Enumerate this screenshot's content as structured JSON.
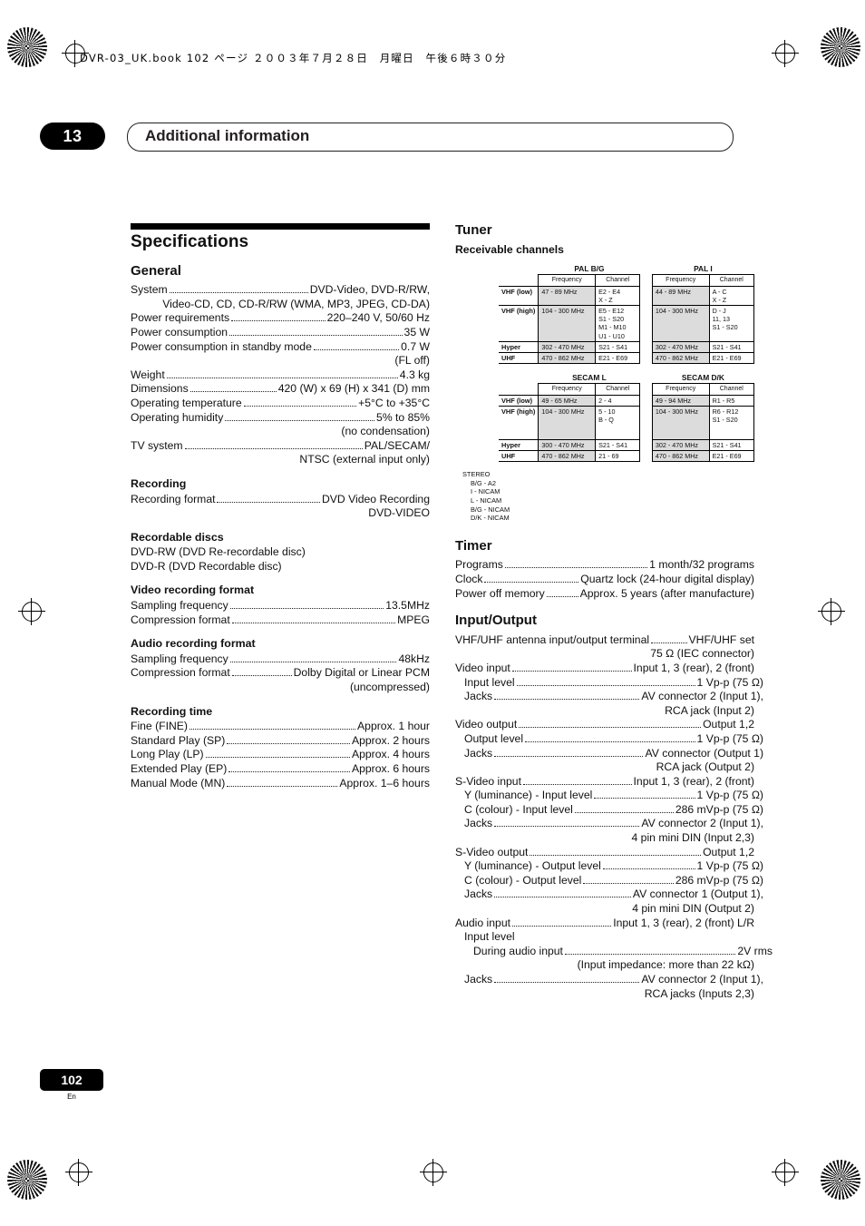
{
  "header": {
    "bookline": "DVR-03_UK.book  102 ページ  ２００３年７月２８日　月曜日　午後６時３０分"
  },
  "chapter": {
    "number": "13",
    "title": "Additional information"
  },
  "page": {
    "number": "102",
    "lang": "En"
  },
  "left": {
    "title": "Specifications",
    "general": {
      "heading": "General",
      "rows": [
        {
          "label": "System",
          "value": "DVD-Video, DVD-R/RW,"
        },
        {
          "cont": "Video-CD, CD, CD-R/RW (WMA, MP3, JPEG, CD-DA)"
        },
        {
          "label": "Power requirements",
          "value": "220–240 V, 50/60 Hz"
        },
        {
          "label": "Power consumption",
          "value": "35 W"
        },
        {
          "label": "Power consumption in standby mode",
          "value": "0.7 W"
        },
        {
          "cont": "(FL off)"
        },
        {
          "label": "Weight",
          "value": "4.3 kg"
        },
        {
          "label": "Dimensions",
          "value": "420 (W) x 69 (H) x 341 (D) mm"
        },
        {
          "label": "Operating temperature",
          "value": "+5°C to +35°C"
        },
        {
          "label": "Operating humidity",
          "value": "5% to 85%"
        },
        {
          "cont": "(no condensation)"
        },
        {
          "label": "TV system",
          "value": "PAL/SECAM/"
        },
        {
          "cont": "NTSC (external input only)"
        }
      ]
    },
    "recording": {
      "heading": "Recording",
      "rows": [
        {
          "label": "Recording format",
          "value": "DVD Video Recording"
        },
        {
          "cont": "DVD-VIDEO"
        }
      ]
    },
    "recordable_discs": {
      "heading": "Recordable discs",
      "lines": [
        "DVD-RW (DVD Re-recordable disc)",
        "DVD-R (DVD Recordable disc)"
      ]
    },
    "video_recording_format": {
      "heading": "Video recording format",
      "rows": [
        {
          "label": "Sampling frequency",
          "value": "13.5MHz"
        },
        {
          "label": "Compression format",
          "value": "MPEG"
        }
      ]
    },
    "audio_recording_format": {
      "heading": "Audio recording format",
      "rows": [
        {
          "label": "Sampling frequency",
          "value": "48kHz"
        },
        {
          "label": "Compression format",
          "value": "Dolby Digital or Linear PCM"
        },
        {
          "cont": "(uncompressed)"
        }
      ]
    },
    "recording_time": {
      "heading": "Recording time",
      "rows": [
        {
          "label": "Fine (FINE)",
          "value": "Approx. 1 hour"
        },
        {
          "label": "Standard Play (SP)",
          "value": "Approx. 2 hours"
        },
        {
          "label": "Long Play (LP)",
          "value": "Approx. 4 hours"
        },
        {
          "label": "Extended Play (EP)",
          "value": "Approx. 6 hours"
        },
        {
          "label": "Manual Mode (MN)",
          "value": "Approx. 1–6 hours"
        }
      ]
    }
  },
  "right": {
    "tuner": {
      "heading": "Tuner",
      "subheading": "Receivable channels",
      "table1": {
        "groups": [
          "PAL B/G",
          "PAL I"
        ],
        "colheads": [
          "Frequency",
          "Channel",
          "Frequency",
          "Channel"
        ],
        "rows": [
          {
            "label": "VHF (low)",
            "cells": [
              "47 - 89 MHz",
              "E2 - E4\nX - Z",
              "44 - 89 MHz",
              "A - C\nX - Z"
            ]
          },
          {
            "label": "VHF (high)",
            "cells": [
              "104 - 300 MHz",
              "E5 - E12\nS1 - S20\nM1 - M10\nU1 - U10",
              "104 - 300 MHz",
              "D - J\n11, 13\nS1 - S20"
            ]
          },
          {
            "label": "Hyper",
            "cells": [
              "302 - 470 MHz",
              "S21 - S41",
              "302 - 470 MHz",
              "S21 - S41"
            ]
          },
          {
            "label": "UHF",
            "cells": [
              "470 - 862 MHz",
              "E21 - E69",
              "470 - 862 MHz",
              "E21 - E69"
            ]
          }
        ]
      },
      "table2": {
        "groups": [
          "SECAM L",
          "SECAM D/K"
        ],
        "colheads": [
          "Frequency",
          "Channel",
          "Frequency",
          "Channel"
        ],
        "rows": [
          {
            "label": "VHF (low)",
            "cells": [
              "49 - 65 MHz",
              "2 - 4",
              "49 - 94 MHz",
              "R1 - R5"
            ]
          },
          {
            "label": "VHF (high)",
            "cells": [
              "104 - 300 MHz",
              "5 - 10\nB - Q",
              "104 - 300 MHz",
              "R6 - R12\nS1 - S20"
            ]
          },
          {
            "label": "Hyper",
            "cells": [
              "300 - 470 MHz",
              "S21 - S41",
              "302 - 470 MHz",
              "S21 - S41"
            ]
          },
          {
            "label": "UHF",
            "cells": [
              "470 - 862 MHz",
              "21 - 69",
              "470 - 862 MHz",
              "E21 - E69"
            ]
          }
        ]
      },
      "stereo": {
        "title": "STEREO",
        "items": [
          "B/G - A2",
          "I - NICAM",
          "L - NICAM",
          "B/G - NICAM",
          "D/K - NICAM"
        ]
      }
    },
    "timer": {
      "heading": "Timer",
      "rows": [
        {
          "label": "Programs",
          "value": "1 month/32 programs"
        },
        {
          "label": "Clock",
          "value": "Quartz lock (24-hour digital display)"
        },
        {
          "label": "Power off memory",
          "value": "Approx. 5 years (after manufacture)"
        }
      ]
    },
    "io": {
      "heading": "Input/Output",
      "rows": [
        {
          "label": "VHF/UHF antenna input/output terminal",
          "value": "VHF/UHF set"
        },
        {
          "cont": "75 Ω (IEC connector)"
        },
        {
          "label": "Video input",
          "value": "Input 1, 3 (rear), 2 (front)"
        },
        {
          "label": "Input level",
          "value": "1 Vp-p (75 Ω)",
          "indent": true
        },
        {
          "label": "Jacks",
          "value": "AV connector 2 (Input 1),",
          "indent": true
        },
        {
          "cont": "RCA jack (Input 2)"
        },
        {
          "label": "Video output",
          "value": "Output 1,2"
        },
        {
          "label": "Output level",
          "value": "1 Vp-p (75 Ω)",
          "indent": true
        },
        {
          "label": "Jacks",
          "value": "AV connector (Output 1)",
          "indent": true
        },
        {
          "cont": "RCA jack (Output 2)"
        },
        {
          "label": "S-Video input",
          "value": "Input 1, 3 (rear), 2 (front)"
        },
        {
          "label": "Y (luminance) - Input level",
          "value": "1 Vp-p (75 Ω)",
          "indent": true
        },
        {
          "label": "C (colour) - Input level",
          "value": "286 mVp-p (75 Ω)",
          "indent": true
        },
        {
          "label": "Jacks",
          "value": "AV connector 2 (Input 1),",
          "indent": true
        },
        {
          "cont": "4 pin mini DIN (Input 2,3)"
        },
        {
          "label": "S-Video output",
          "value": "Output 1,2"
        },
        {
          "label": "Y (luminance) - Output level",
          "value": "1 Vp-p (75 Ω)",
          "indent": true
        },
        {
          "label": "C (colour) - Output level",
          "value": "286 mVp-p (75 Ω)",
          "indent": true
        },
        {
          "label": "Jacks",
          "value": "AV connector 1 (Output 1),",
          "indent": true
        },
        {
          "cont": "4 pin mini DIN (Output 2)"
        },
        {
          "label": "Audio input",
          "value": "Input 1, 3 (rear), 2 (front) L/R"
        },
        {
          "plain": "Input level",
          "indent": true
        },
        {
          "label": "During audio input",
          "value": "2V rms",
          "indent2": true
        },
        {
          "cont": "(Input impedance: more than 22 kΩ)"
        },
        {
          "label": "Jacks",
          "value": "AV connector 2 (Input 1),",
          "indent": true
        },
        {
          "cont": "RCA jacks (Inputs 2,3)"
        }
      ]
    }
  }
}
